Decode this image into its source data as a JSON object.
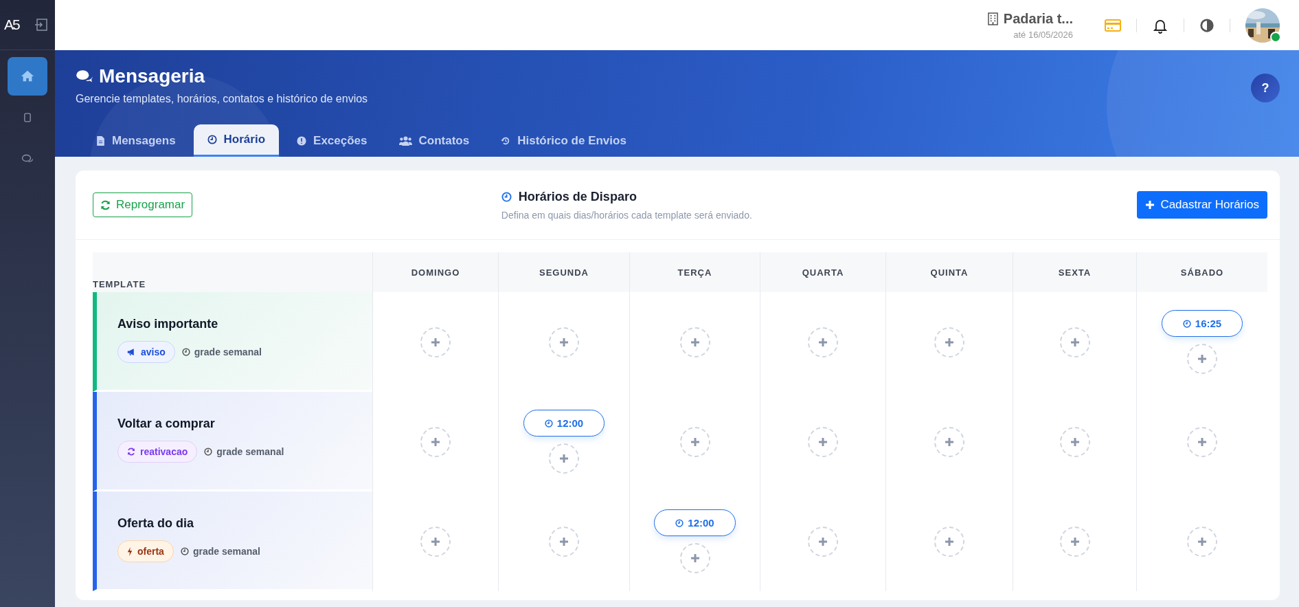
{
  "brand": {
    "logo": "A5"
  },
  "sidebar": {
    "items": [
      {
        "selected": true
      },
      {
        "selected": false
      },
      {
        "selected": false
      }
    ]
  },
  "topbar": {
    "company": "Padaria t...",
    "valid_until": "até 16/05/2026"
  },
  "header": {
    "title": "Mensageria",
    "subtitle": "Gerencie templates, horários, contatos e histórico de envios",
    "help": "?"
  },
  "tabs": [
    {
      "label": "Mensagens",
      "selected": false
    },
    {
      "label": "Horário",
      "selected": true
    },
    {
      "label": "Exceções",
      "selected": false
    },
    {
      "label": "Contatos",
      "selected": false
    },
    {
      "label": "Histórico de Envios",
      "selected": false
    }
  ],
  "panel": {
    "reschedule_button": "Reprogramar",
    "title": "Horários de Disparo",
    "subtitle": "Defina em quais dias/horários cada template será enviado.",
    "add_button": "Cadastrar Horários"
  },
  "table": {
    "template_column": "TEMPLATE",
    "days": [
      "DOMINGO",
      "SEGUNDA",
      "TERÇA",
      "QUARTA",
      "QUINTA",
      "SEXTA",
      "SÁBADO"
    ],
    "rows": [
      {
        "name": "Aviso importante",
        "tag": "aviso",
        "kind": "aviso",
        "color": "#10b981",
        "mode": "grade semanal",
        "slots": [
          {
            "kind": "empty"
          },
          {
            "kind": "empty"
          },
          {
            "kind": "empty"
          },
          {
            "kind": "empty"
          },
          {
            "kind": "empty"
          },
          {
            "kind": "empty"
          },
          {
            "kind": "scheduled",
            "time": "16:25"
          }
        ]
      },
      {
        "name": "Voltar a comprar",
        "tag": "reativacao",
        "kind": "reativacao",
        "color": "#2563eb",
        "mode": "grade semanal",
        "slots": [
          {
            "kind": "empty"
          },
          {
            "kind": "scheduled",
            "time": "12:00"
          },
          {
            "kind": "empty"
          },
          {
            "kind": "empty"
          },
          {
            "kind": "empty"
          },
          {
            "kind": "empty"
          },
          {
            "kind": "empty"
          }
        ]
      },
      {
        "name": "Oferta do dia",
        "tag": "oferta",
        "kind": "oferta",
        "color": "#2563eb",
        "mode": "grade semanal",
        "slots": [
          {
            "kind": "empty"
          },
          {
            "kind": "empty"
          },
          {
            "kind": "scheduled",
            "time": "12:00"
          },
          {
            "kind": "empty"
          },
          {
            "kind": "empty"
          },
          {
            "kind": "empty"
          },
          {
            "kind": "empty"
          }
        ]
      }
    ]
  }
}
